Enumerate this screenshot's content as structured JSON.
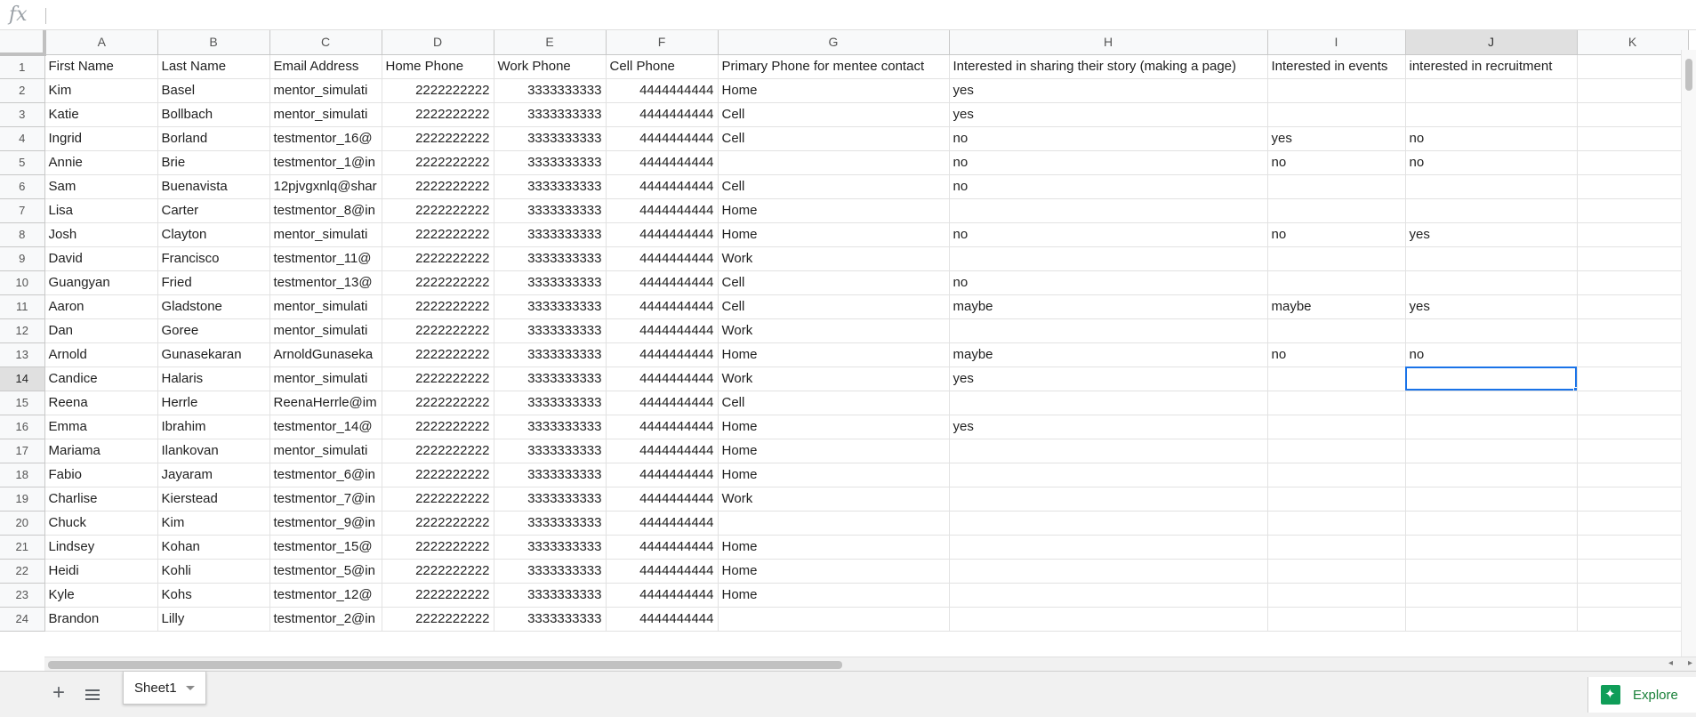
{
  "formula_bar": {
    "fx": "fx",
    "value": ""
  },
  "columns": [
    "A",
    "B",
    "C",
    "D",
    "E",
    "F",
    "G",
    "H",
    "I",
    "J",
    "K"
  ],
  "selected_column": "J",
  "selected_row": 14,
  "header_row": [
    "First Name",
    "Last Name",
    "Email Address",
    "Home Phone",
    "Work Phone",
    "Cell Phone",
    "Primary Phone for mentee contact",
    "Interested in sharing their story (making a page)",
    "Interested in events",
    "interested in recruitment",
    ""
  ],
  "rows": [
    [
      "Kim",
      "Basel",
      "mentor_simulati",
      "2222222222",
      "3333333333",
      "4444444444",
      "Home",
      "yes",
      "",
      ""
    ],
    [
      "Katie",
      "Bollbach",
      "mentor_simulati",
      "2222222222",
      "3333333333",
      "4444444444",
      "Cell",
      "yes",
      "",
      ""
    ],
    [
      "Ingrid",
      "Borland",
      "testmentor_16@",
      "2222222222",
      "3333333333",
      "4444444444",
      "Cell",
      "no",
      "yes",
      "no"
    ],
    [
      "Annie",
      "Brie",
      "testmentor_1@in",
      "2222222222",
      "3333333333",
      "4444444444",
      "",
      "no",
      "no",
      "no"
    ],
    [
      "Sam",
      "Buenavista",
      "12pjvgxnlq@shar",
      "2222222222",
      "3333333333",
      "4444444444",
      "Cell",
      "no",
      "",
      ""
    ],
    [
      "Lisa",
      "Carter",
      "testmentor_8@in",
      "2222222222",
      "3333333333",
      "4444444444",
      "Home",
      "",
      "",
      ""
    ],
    [
      "Josh",
      "Clayton",
      "mentor_simulati",
      "2222222222",
      "3333333333",
      "4444444444",
      "Home",
      "no",
      "no",
      "yes"
    ],
    [
      "David",
      "Francisco",
      "testmentor_11@",
      "2222222222",
      "3333333333",
      "4444444444",
      "Work",
      "",
      "",
      ""
    ],
    [
      "Guangyan",
      "Fried",
      "testmentor_13@",
      "2222222222",
      "3333333333",
      "4444444444",
      "Cell",
      "no",
      "",
      ""
    ],
    [
      "Aaron",
      "Gladstone",
      "mentor_simulati",
      "2222222222",
      "3333333333",
      "4444444444",
      "Cell",
      "maybe",
      "maybe",
      "yes"
    ],
    [
      "Dan",
      "Goree",
      "mentor_simulati",
      "2222222222",
      "3333333333",
      "4444444444",
      "Work",
      "",
      "",
      ""
    ],
    [
      "Arnold",
      "Gunasekaran",
      "ArnoldGunaseka",
      "2222222222",
      "3333333333",
      "4444444444",
      "Home",
      "maybe",
      "no",
      "no"
    ],
    [
      "Candice",
      "Halaris",
      "mentor_simulati",
      "2222222222",
      "3333333333",
      "4444444444",
      "Work",
      "yes",
      "",
      ""
    ],
    [
      "Reena",
      "Herrle",
      "ReenaHerrle@im",
      "2222222222",
      "3333333333",
      "4444444444",
      "Cell",
      "",
      "",
      ""
    ],
    [
      "Emma",
      "Ibrahim",
      "testmentor_14@",
      "2222222222",
      "3333333333",
      "4444444444",
      "Home",
      "yes",
      "",
      ""
    ],
    [
      "Mariama",
      "Ilankovan",
      "mentor_simulati",
      "2222222222",
      "3333333333",
      "4444444444",
      "Home",
      "",
      "",
      ""
    ],
    [
      "Fabio",
      "Jayaram",
      "testmentor_6@in",
      "2222222222",
      "3333333333",
      "4444444444",
      "Home",
      "",
      "",
      ""
    ],
    [
      "Charlise",
      "Kierstead",
      "testmentor_7@in",
      "2222222222",
      "3333333333",
      "4444444444",
      "Work",
      "",
      "",
      ""
    ],
    [
      "Chuck",
      "Kim",
      "testmentor_9@in",
      "2222222222",
      "3333333333",
      "4444444444",
      "",
      "",
      "",
      ""
    ],
    [
      "Lindsey",
      "Kohan",
      "testmentor_15@",
      "2222222222",
      "3333333333",
      "4444444444",
      "Home",
      "",
      "",
      ""
    ],
    [
      "Heidi",
      "Kohli",
      "testmentor_5@in",
      "2222222222",
      "3333333333",
      "4444444444",
      "Home",
      "",
      "",
      ""
    ],
    [
      "Kyle",
      "Kohs",
      "testmentor_12@",
      "2222222222",
      "3333333333",
      "4444444444",
      "Home",
      "",
      "",
      ""
    ],
    [
      "Brandon",
      "Lilly",
      "testmentor_2@in",
      "2222222222",
      "3333333333",
      "4444444444",
      "",
      "",
      "",
      ""
    ]
  ],
  "sheetbar": {
    "add_icon": "+",
    "tabs": [
      {
        "label": "Sheet1",
        "active": true
      }
    ],
    "explore_label": "Explore"
  }
}
